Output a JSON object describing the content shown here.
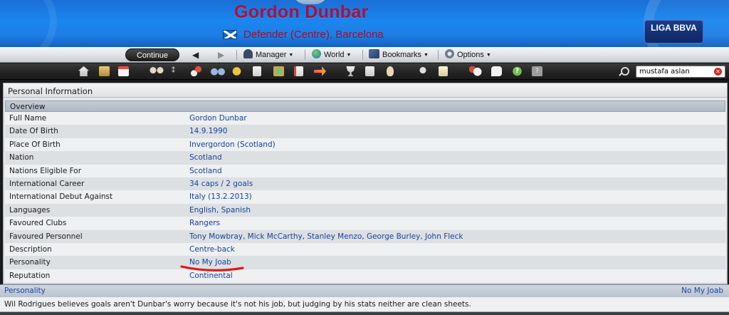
{
  "header": {
    "player_name": "Gordon Dunbar",
    "player_role": "Defender (Centre), Barcelona",
    "league_logo": "LIGA BBVA",
    "flag_icon": "scotland-flag-icon",
    "accent_color": "#a8123c",
    "header_color": "#1a86ef"
  },
  "nav": {
    "continue_label": "Continue",
    "menus": [
      {
        "label": "Manager",
        "icon": "manager-icon"
      },
      {
        "label": "World",
        "icon": "globe-icon"
      },
      {
        "label": "Bookmarks",
        "icon": "bookmarks-icon"
      },
      {
        "label": "Options",
        "icon": "options-icon"
      }
    ]
  },
  "toolbar": {
    "icons": [
      "home-icon",
      "inbox-icon",
      "calendar-icon",
      "squad-icon",
      "tactics-icon",
      "training-icon",
      "scouting-icon",
      "finances-icon",
      "board-icon",
      "club-icon",
      "news-icon",
      "transfer-icon",
      "competitions-icon",
      "league-icon",
      "player-search-icon",
      "staff-icon",
      "notes-icon",
      "history-icon",
      "chat-icon",
      "help-icon",
      "info-icon"
    ],
    "search_value": "mustafa aslan"
  },
  "panel": {
    "title": "Personal Information",
    "section": "Overview",
    "rows": [
      {
        "label": "Full Name",
        "value": "Gordon Dunbar"
      },
      {
        "label": "Date Of Birth",
        "value": "14.9.1990"
      },
      {
        "label": "Place Of Birth",
        "value": "Invergordon (Scotland)"
      },
      {
        "label": "Nation",
        "value": "Scotland"
      },
      {
        "label": "Nations Eligible For",
        "value": "Scotland"
      },
      {
        "label": "International Career",
        "value": "34 caps / 2 goals"
      },
      {
        "label": "International Debut Against",
        "value": "Italy (13.2.2013)"
      },
      {
        "label": "Languages",
        "value": "English, Spanish"
      },
      {
        "label": "Favoured Clubs",
        "value": "Rangers"
      },
      {
        "label": "Favoured Personnel",
        "value": "Tony Mowbray, Mick McCarthy, Stanley Menzo, George Burley, John Fleck"
      },
      {
        "label": "Description",
        "value": "Centre-back"
      },
      {
        "label": "Personality",
        "value": "No My Joab"
      },
      {
        "label": "Reputation",
        "value": "Continental"
      }
    ]
  },
  "info": {
    "left_label": "Personality",
    "right_value": "No My Joab",
    "description": "Wil Rodrigues believes goals aren't Dunbar's worry because it's not his job, but judging by his stats neither are clean sheets."
  }
}
